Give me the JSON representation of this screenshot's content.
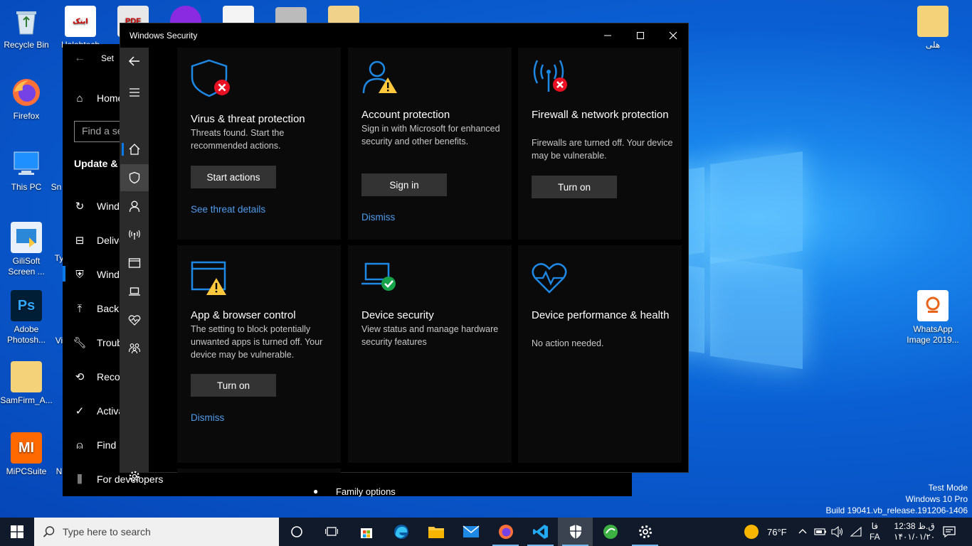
{
  "desktop_icons": {
    "recycle_bin": "Recycle Bin",
    "halabtech": "Halabtech",
    "firefox": "Firefox",
    "this_pc": "This PC",
    "sn": "Sn",
    "gilisoft": "GiliSoft Screen ...",
    "ty": "Ty",
    "photoshop": "Adobe Photosh...",
    "vi": "Vi",
    "samfirm": "SamFirm_A...",
    "mipc": "MiPCSuite",
    "n": "N",
    "folder_rtl": "هلی",
    "whatsapp": "WhatsApp Image 2019...",
    "ps_badge": "Ps",
    "mi_badge": "MI",
    "pdf_badge": "PDF",
    "halabtech_badge": "ابتک"
  },
  "settings_window": {
    "title": "Set",
    "search_placeholder": "Find a se",
    "section_heading": "Update &",
    "nav": {
      "home": "Home",
      "windows_update": "Wind",
      "delivery": "Delive",
      "windows_security": "Wind",
      "backup": "Backu",
      "troubleshoot": "Troub",
      "recovery": "Recov",
      "activation": "Activa",
      "find_device": "Find r",
      "for_developers": "For developers"
    },
    "family_options": "Family options"
  },
  "security_window": {
    "title": "Windows Security",
    "tiles": {
      "virus": {
        "title": "Virus & threat protection",
        "description": "Threats found. Start the recommended actions.",
        "button": "Start actions",
        "link": "See threat details"
      },
      "account": {
        "title": "Account protection",
        "description": "Sign in with Microsoft for enhanced security and other benefits.",
        "button": "Sign in",
        "link": "Dismiss"
      },
      "firewall": {
        "title": "Firewall & network protection",
        "description": "Firewalls are turned off. Your device may be vulnerable.",
        "button": "Turn on"
      },
      "app_browser": {
        "title": "App & browser control",
        "description": "The setting to block potentially unwanted apps is turned off. Your device may be vulnerable.",
        "button": "Turn on",
        "link": "Dismiss"
      },
      "device_security": {
        "title": "Device security",
        "description": "View status and manage hardware security features"
      },
      "device_performance": {
        "title": "Device performance & health",
        "description": "No action needed."
      }
    }
  },
  "watermark": {
    "line1": "Test Mode",
    "line2": "Windows 10 Pro",
    "line3": "Build 19041.vb_release.191206-1406"
  },
  "taskbar": {
    "search_placeholder": "Type here to search",
    "weather": "76°F",
    "language_top": "فا",
    "language": "FA",
    "time": "12:38 ق.ظ",
    "date": "۱۴۰۱/۰۱/۲۰"
  },
  "colors": {
    "accent": "#0a7ae8",
    "link": "#4f9dee",
    "danger": "#e81123",
    "warning": "#ffc83d",
    "ok": "#16a34a"
  }
}
